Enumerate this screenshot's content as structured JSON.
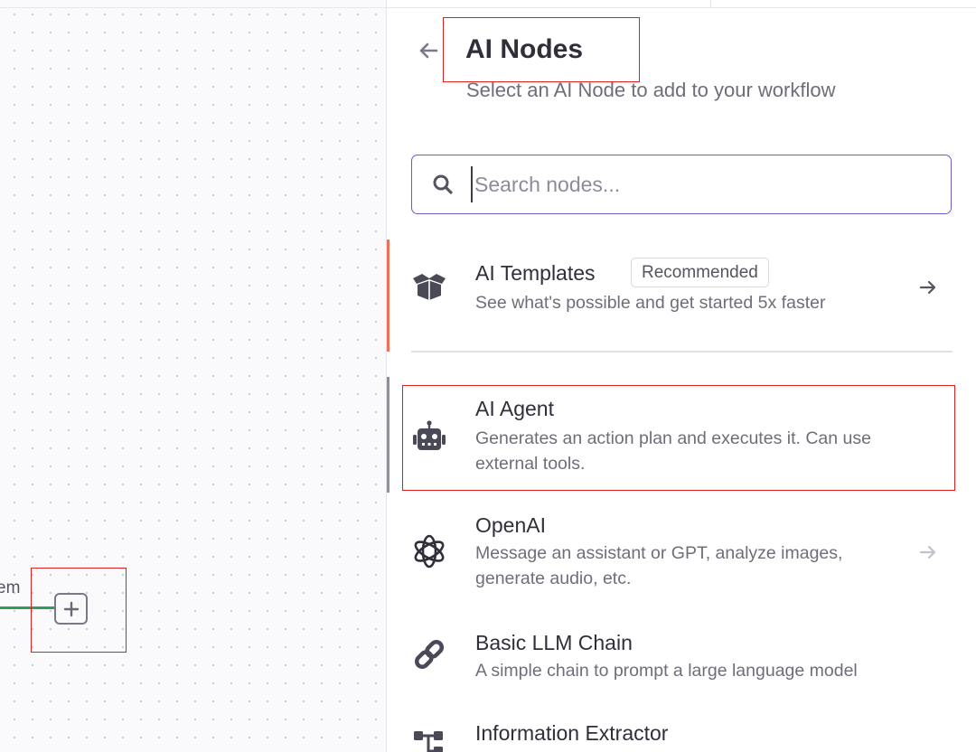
{
  "canvas": {
    "node_label_partial": "em"
  },
  "panel": {
    "title": "AI Nodes",
    "subtitle": "Select an AI Node to add to your workflow",
    "search": {
      "placeholder": "Search nodes...",
      "value": ""
    },
    "items": [
      {
        "name": "AI Templates",
        "badge": "Recommended",
        "description": "See what's possible and get started 5x faster",
        "icon": "box-open-icon",
        "accent_color": "#f0705a"
      },
      {
        "name": "AI Agent",
        "description_lines": [
          "Generates an action plan and executes it. Can use",
          "external tools."
        ],
        "icon": "robot-icon",
        "accent_color": "#909098"
      },
      {
        "name": "OpenAI",
        "description_lines": [
          "Message an assistant or GPT, analyze images,",
          "generate audio, etc."
        ],
        "icon": "openai-icon"
      },
      {
        "name": "Basic LLM Chain",
        "description": "A simple chain to prompt a large language model",
        "icon": "link-icon"
      },
      {
        "name": "Information Extractor",
        "icon": "extractor-icon"
      }
    ]
  },
  "colors": {
    "accent_purple": "#6a5bc9",
    "connector_green": "#2f9e5a",
    "highlight_red": "#e02020",
    "templates_accent": "#f0705a"
  }
}
